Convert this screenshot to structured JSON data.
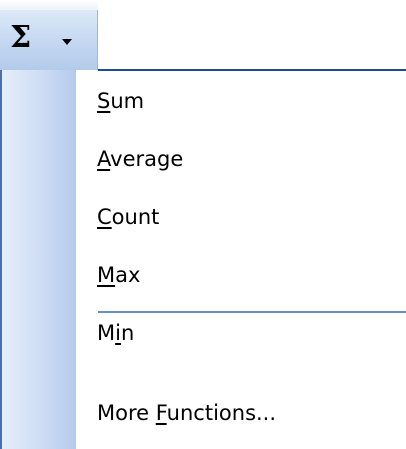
{
  "toolbar": {
    "button_symbol": "Σ",
    "button_icon": "sigma-icon",
    "arrow_icon": "chevron-down-icon"
  },
  "menu": {
    "items": [
      {
        "id": "sum",
        "pre": "",
        "accel": "S",
        "post": "um"
      },
      {
        "id": "average",
        "pre": "",
        "accel": "A",
        "post": "verage"
      },
      {
        "id": "count",
        "pre": "",
        "accel": "C",
        "post": "ount"
      },
      {
        "id": "max",
        "pre": "",
        "accel": "M",
        "post": "ax"
      },
      {
        "id": "min",
        "pre": "M",
        "accel": "i",
        "post": "n"
      },
      {
        "id": "more-functions",
        "pre": "More ",
        "accel": "F",
        "post": "unctions..."
      }
    ]
  },
  "colors": {
    "menu_border": "#1f4b96",
    "gutter_light": "#e6eefa",
    "gutter_dark": "#b5cbec",
    "separator": "#6a8dc7"
  }
}
